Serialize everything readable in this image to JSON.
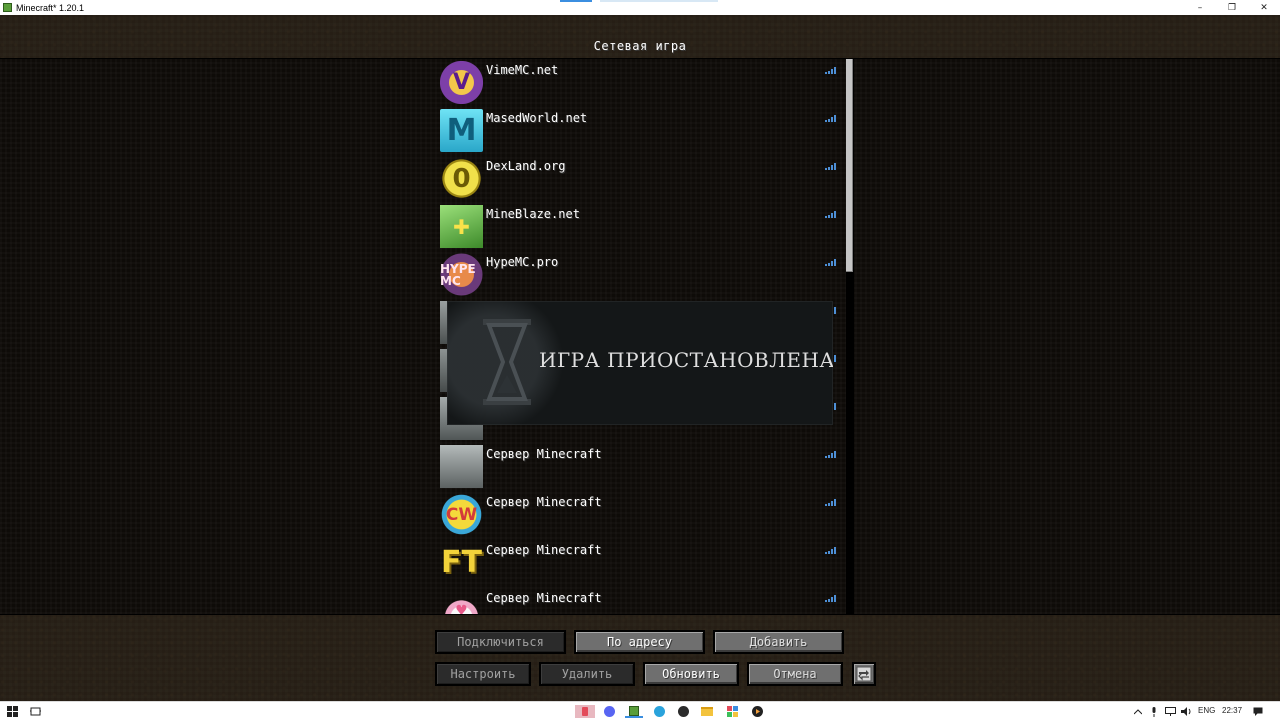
{
  "window": {
    "title": "Minecraft* 1.20.1",
    "minimize_glyph": "–",
    "maximize_glyph": "❐",
    "close_glyph": "✕"
  },
  "screen": {
    "title": "Сетевая игра"
  },
  "servers": [
    {
      "name": "VimeMC.net",
      "icon": "vimemc-logo",
      "thumb_text": "V"
    },
    {
      "name": "MasedWorld.net",
      "icon": "masedworld-logo",
      "thumb_text": "M"
    },
    {
      "name": "DexLand.org",
      "icon": "dexland-coin-logo",
      "thumb_text": "0"
    },
    {
      "name": "MineBlaze.net",
      "icon": "mineblaze-cash-logo",
      "thumb_text": "✚"
    },
    {
      "name": "HypeMC.pro",
      "icon": "hypemc-logo",
      "thumb_text": "HYPE MC"
    },
    {
      "name": "",
      "icon": "gray-world-thumbnail",
      "thumb_text": ""
    },
    {
      "name": "",
      "icon": "gray-world-thumbnail",
      "thumb_text": ""
    },
    {
      "name": "",
      "icon": "gray-world-thumbnail",
      "thumb_text": ""
    },
    {
      "name": "Сервер Minecraft",
      "icon": "landscape-thumbnail",
      "thumb_text": ""
    },
    {
      "name": "Сервер Minecraft",
      "icon": "cw-logo",
      "thumb_text": "CW"
    },
    {
      "name": "Сервер Minecraft",
      "icon": "ft-logo",
      "thumb_text": "FT"
    },
    {
      "name": "Сервер Minecraft",
      "icon": "hearts-logo",
      "thumb_text": "♥"
    }
  ],
  "paused_overlay": {
    "text": "ИГРА ПРИОСТАНОВЛЕНА",
    "icon": "hourglass-icon"
  },
  "buttons": {
    "connect": "Подключиться",
    "by_address": "По адресу",
    "add": "Добавить",
    "edit": "Настроить",
    "delete": "Удалить",
    "refresh": "Обновить",
    "cancel": "Отмена"
  },
  "taskbar": {
    "language": "ENG",
    "time": "22:37"
  },
  "colors": {
    "signal_bars": "#4d8fd6",
    "button_face": "#6f6f6f",
    "button_disabled": "#2b2b2b"
  }
}
